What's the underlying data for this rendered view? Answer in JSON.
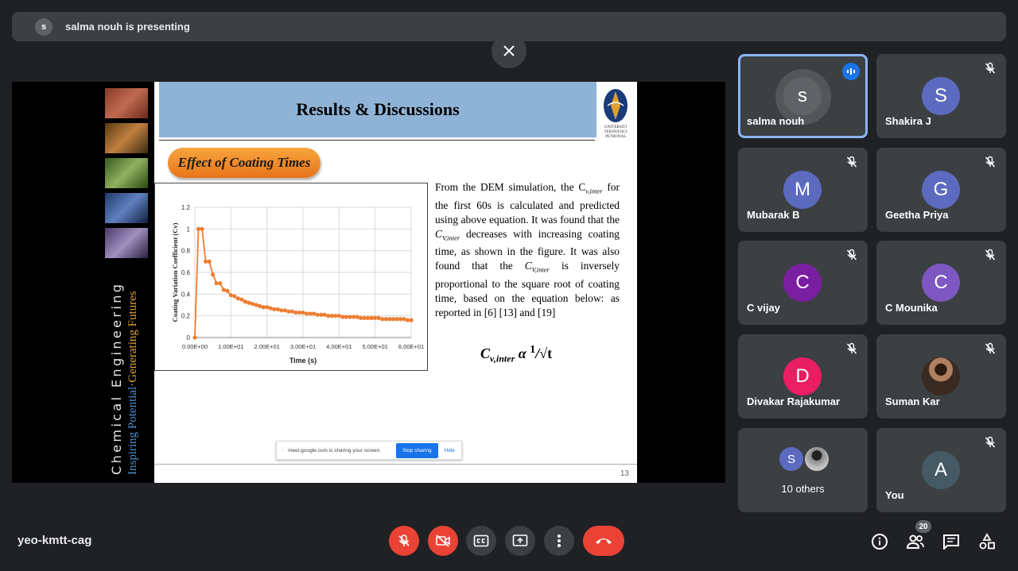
{
  "topbar": {
    "presenter_initial": "s",
    "presenting_text": "salma nouh is presenting"
  },
  "slide": {
    "title": "Results & Discussions",
    "logo_text": "UNIVERSITI\nTEKNOLOGI\nPETRONAS",
    "side_line1": "Chemical Engineering",
    "side_line2a": "Inspiring Potential",
    "side_line2b": "·Generating Futures",
    "pill": "Effect of Coating Times",
    "para_parts": {
      "p1": "From the DEM simulation, the C",
      "s1": "v,inter",
      "p2": " for the first 60s is calculated and predicted using above equation. It was found that the ",
      "c2": "C",
      "s2": "V,inter",
      "p3": " decreases with increasing coating time, as shown in the figure. It was also found that the ",
      "c3": "C",
      "s3": "V,inter",
      "p4": " is inversely proportional to the square root of coating time, based on the equation below: as reported in [6] [13] and [19]"
    },
    "equation": {
      "c": "C",
      "sub": "v,inter",
      "rest": " α ",
      "num": "1",
      "den": "√t"
    },
    "page": "13",
    "share": {
      "grip": "⁞",
      "msg": "meet.google.com is sharing your screen.",
      "stop": "Stop sharing",
      "hide": "Hide"
    }
  },
  "chart_data": {
    "type": "line",
    "xlabel": "Time (s)",
    "ylabel": "Coating Variation Coefficient (Cv)",
    "ylim": [
      0,
      1.2
    ],
    "xlim": [
      0,
      60
    ],
    "yticks": [
      "0",
      "0.2",
      "0.4",
      "0.6",
      "0.8",
      "1",
      "1.2"
    ],
    "xticks": [
      "0.00E+00",
      "1.00E+01",
      "2.00E+01",
      "3.00E+01",
      "4.00E+01",
      "5.00E+01",
      "6.00E+01"
    ],
    "grid": true,
    "series": [
      {
        "color": "#ed7d31",
        "x": [
          0,
          1,
          2,
          3,
          4,
          5,
          6,
          7,
          8,
          9,
          10,
          11,
          12,
          13,
          14,
          15,
          16,
          17,
          18,
          19,
          20,
          21,
          22,
          23,
          24,
          25,
          26,
          27,
          28,
          29,
          30,
          31,
          32,
          33,
          34,
          35,
          36,
          37,
          38,
          39,
          40,
          41,
          42,
          43,
          44,
          45,
          46,
          47,
          48,
          49,
          50,
          51,
          52,
          53,
          54,
          55,
          56,
          57,
          58,
          59,
          60
        ],
        "y": [
          0,
          1.0,
          1.0,
          0.7,
          0.7,
          0.58,
          0.5,
          0.5,
          0.44,
          0.43,
          0.39,
          0.38,
          0.36,
          0.35,
          0.33,
          0.32,
          0.31,
          0.3,
          0.29,
          0.28,
          0.28,
          0.27,
          0.26,
          0.26,
          0.25,
          0.25,
          0.24,
          0.24,
          0.23,
          0.23,
          0.23,
          0.22,
          0.22,
          0.22,
          0.21,
          0.21,
          0.21,
          0.2,
          0.2,
          0.2,
          0.2,
          0.19,
          0.19,
          0.19,
          0.19,
          0.19,
          0.18,
          0.18,
          0.18,
          0.18,
          0.18,
          0.18,
          0.17,
          0.17,
          0.17,
          0.17,
          0.17,
          0.17,
          0.17,
          0.16,
          0.16
        ]
      }
    ]
  },
  "participants": [
    {
      "name": "salma nouh",
      "initial": "s",
      "color": "#5f6368",
      "active": true
    },
    {
      "name": "Shakira J",
      "initial": "S",
      "color": "#5c6bc0",
      "muted": true
    },
    {
      "name": "Mubarak B",
      "initial": "M",
      "color": "#5c6bc0",
      "muted": true
    },
    {
      "name": "Geetha Priya",
      "initial": "G",
      "color": "#5c6bc0",
      "muted": true
    },
    {
      "name": "C vijay",
      "initial": "C",
      "color": "#7b1fa2",
      "muted": true
    },
    {
      "name": "C Mounika",
      "initial": "C",
      "color": "#7e57c2",
      "muted": true
    },
    {
      "name": "Divakar Rajakumar",
      "initial": "D",
      "color": "#e91e63",
      "muted": true
    },
    {
      "name": "Suman Kar",
      "initial": "",
      "color": "#6d5a4a",
      "muted": true
    },
    {
      "name": "10 others",
      "initial": "S",
      "color": "#5c6bc0"
    },
    {
      "name": "You",
      "initial": "A",
      "color": "#455a64",
      "muted": true
    }
  ],
  "bottom": {
    "meeting_code": "yeo-kmtt-cag",
    "people_count": "20"
  },
  "colors": {
    "end_call": "#ea4335",
    "active_border": "#8ab4f8",
    "tile_bg": "#3c4043"
  }
}
